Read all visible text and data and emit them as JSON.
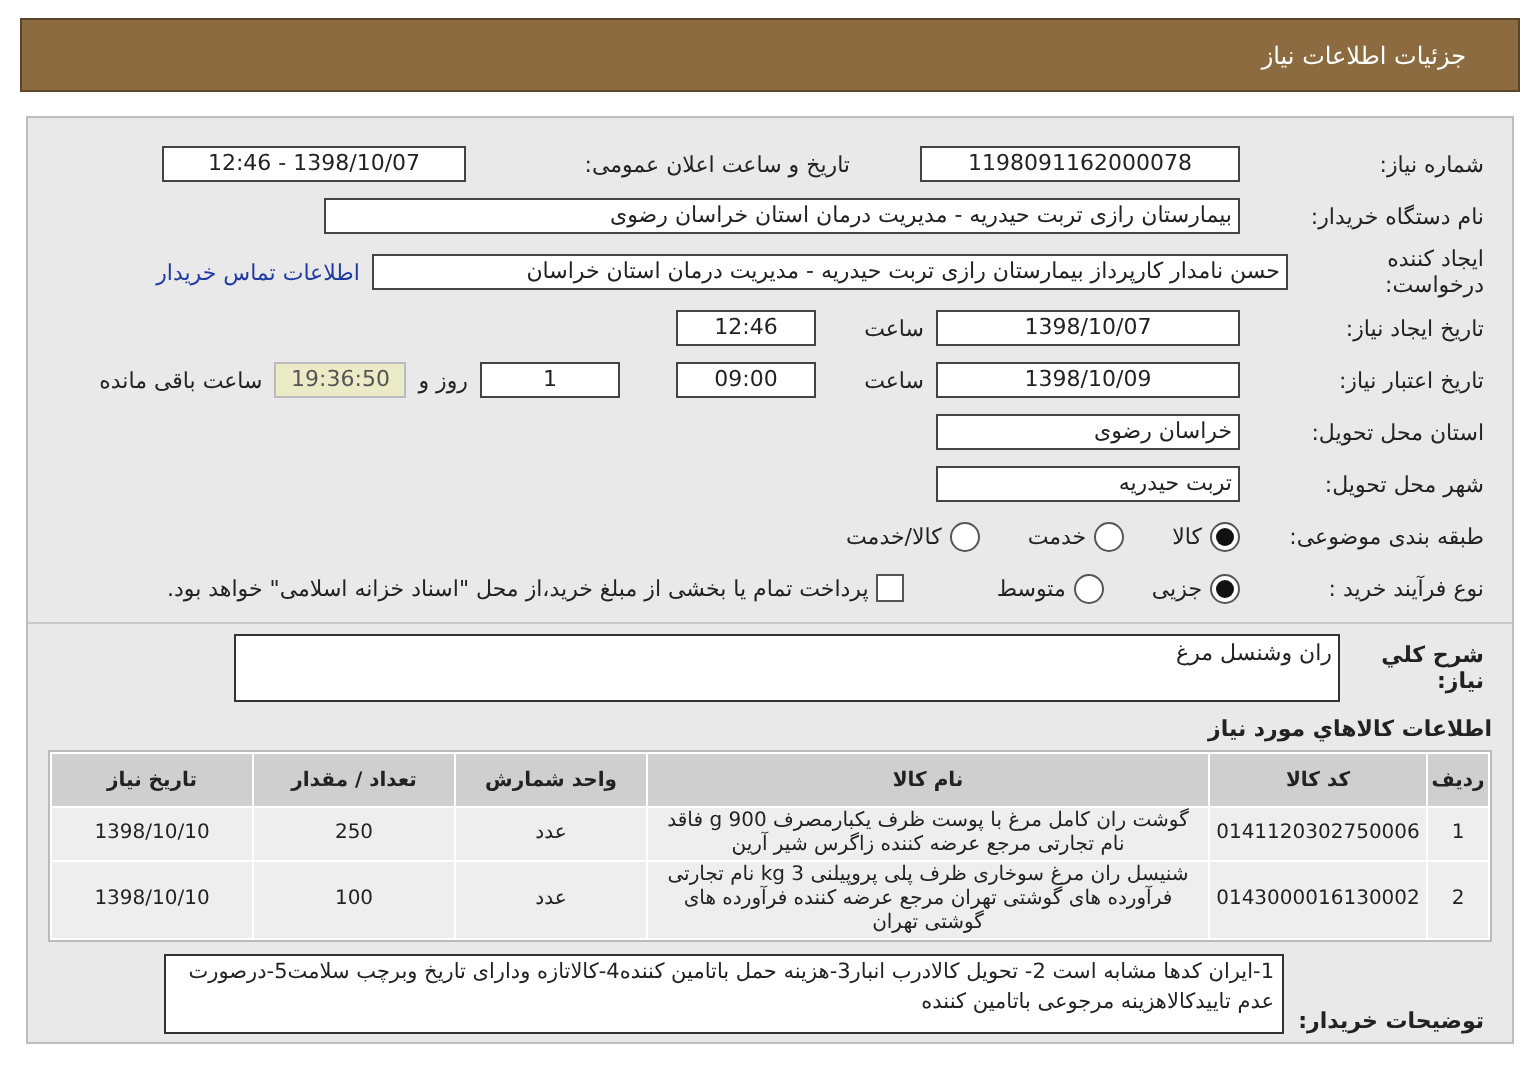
{
  "header": {
    "title": "جزئیات اطلاعات نیاز"
  },
  "need_number": {
    "label": "شماره نیاز:",
    "value": "1198091162000078"
  },
  "announce": {
    "label": "تاریخ و ساعت اعلان عمومی:",
    "value": "1398/10/07 - 12:46"
  },
  "buyer_org": {
    "label": "نام دستگاه خریدار:",
    "value": "بیمارستان رازی تربت حیدریه - مدیریت درمان استان خراسان رضوی"
  },
  "requester": {
    "label": "ایجاد کننده درخواست:",
    "value": "حسن نامدار کارپرداز بیمارستان رازی تربت حیدریه - مدیریت درمان استان خراسان",
    "link": "اطلاعات تماس خریدار"
  },
  "creation": {
    "label": "تاریخ ایجاد نیاز:",
    "date": "1398/10/07",
    "time_label": "ساعت",
    "time": "12:46"
  },
  "validity": {
    "label": "تاریخ اعتبار نیاز:",
    "date": "1398/10/09",
    "time_label": "ساعت",
    "time": "09:00",
    "days": "1",
    "days_label": "روز و",
    "remaining": "19:36:50",
    "remaining_label": "ساعت باقی مانده"
  },
  "province": {
    "label": "استان محل تحویل:",
    "value": "خراسان رضوی"
  },
  "city": {
    "label": "شهر محل تحویل:",
    "value": "تربت حیدریه"
  },
  "category": {
    "label": "طبقه بندی موضوعی:",
    "options": [
      {
        "label": "کالا",
        "selected": true
      },
      {
        "label": "خدمت",
        "selected": false
      },
      {
        "label": "کالا/خدمت",
        "selected": false
      }
    ]
  },
  "purchase_type": {
    "label": "نوع فرآیند خرید :",
    "options": [
      {
        "label": "جزیی",
        "selected": true
      },
      {
        "label": "متوسط",
        "selected": false
      }
    ],
    "payment": {
      "label": "پرداخت تمام یا بخشی از مبلغ خرید،از محل \"اسناد خزانه اسلامی\" خواهد بود.",
      "checked": false
    }
  },
  "description": {
    "label": "شرح کلي نياز:",
    "value": "ران وشنسل مرغ"
  },
  "goods": {
    "title": "اطلاعات کالاهاي مورد نياز",
    "columns": [
      "رديف",
      "کد کالا",
      "نام کالا",
      "واحد شمارش",
      "تعداد / مقدار",
      "تاريخ نياز"
    ],
    "rows": [
      [
        "1",
        "0141120302750006",
        "گوشت ران کامل مرغ با پوست ظرف یکبارمصرف 900 g فاقد نام تجارتی مرجع عرضه کننده زاگرس شیر آرین",
        "عدد",
        "250",
        "1398/10/10"
      ],
      [
        "2",
        "0143000016130002",
        "شنیسل ران مرغ سوخاری ظرف پلی پروپیلنی 3 kg نام تجارتی فرآورده های گوشتی تهران مرجع عرضه کننده فرآورده های گوشتی تهران",
        "عدد",
        "100",
        "1398/10/10"
      ]
    ]
  },
  "buyer_notes": {
    "label": "توضیحات خریدار:",
    "value": "1-ایران کدها مشابه است 2- تحویل کالادرب انبار3-هزینه حمل باتامین کننده4-کالاتازه ودارای تاریخ وبرچب سلامت5-درصورت عدم تاییدکالاهزینه مرجوعی باتامین کننده"
  }
}
